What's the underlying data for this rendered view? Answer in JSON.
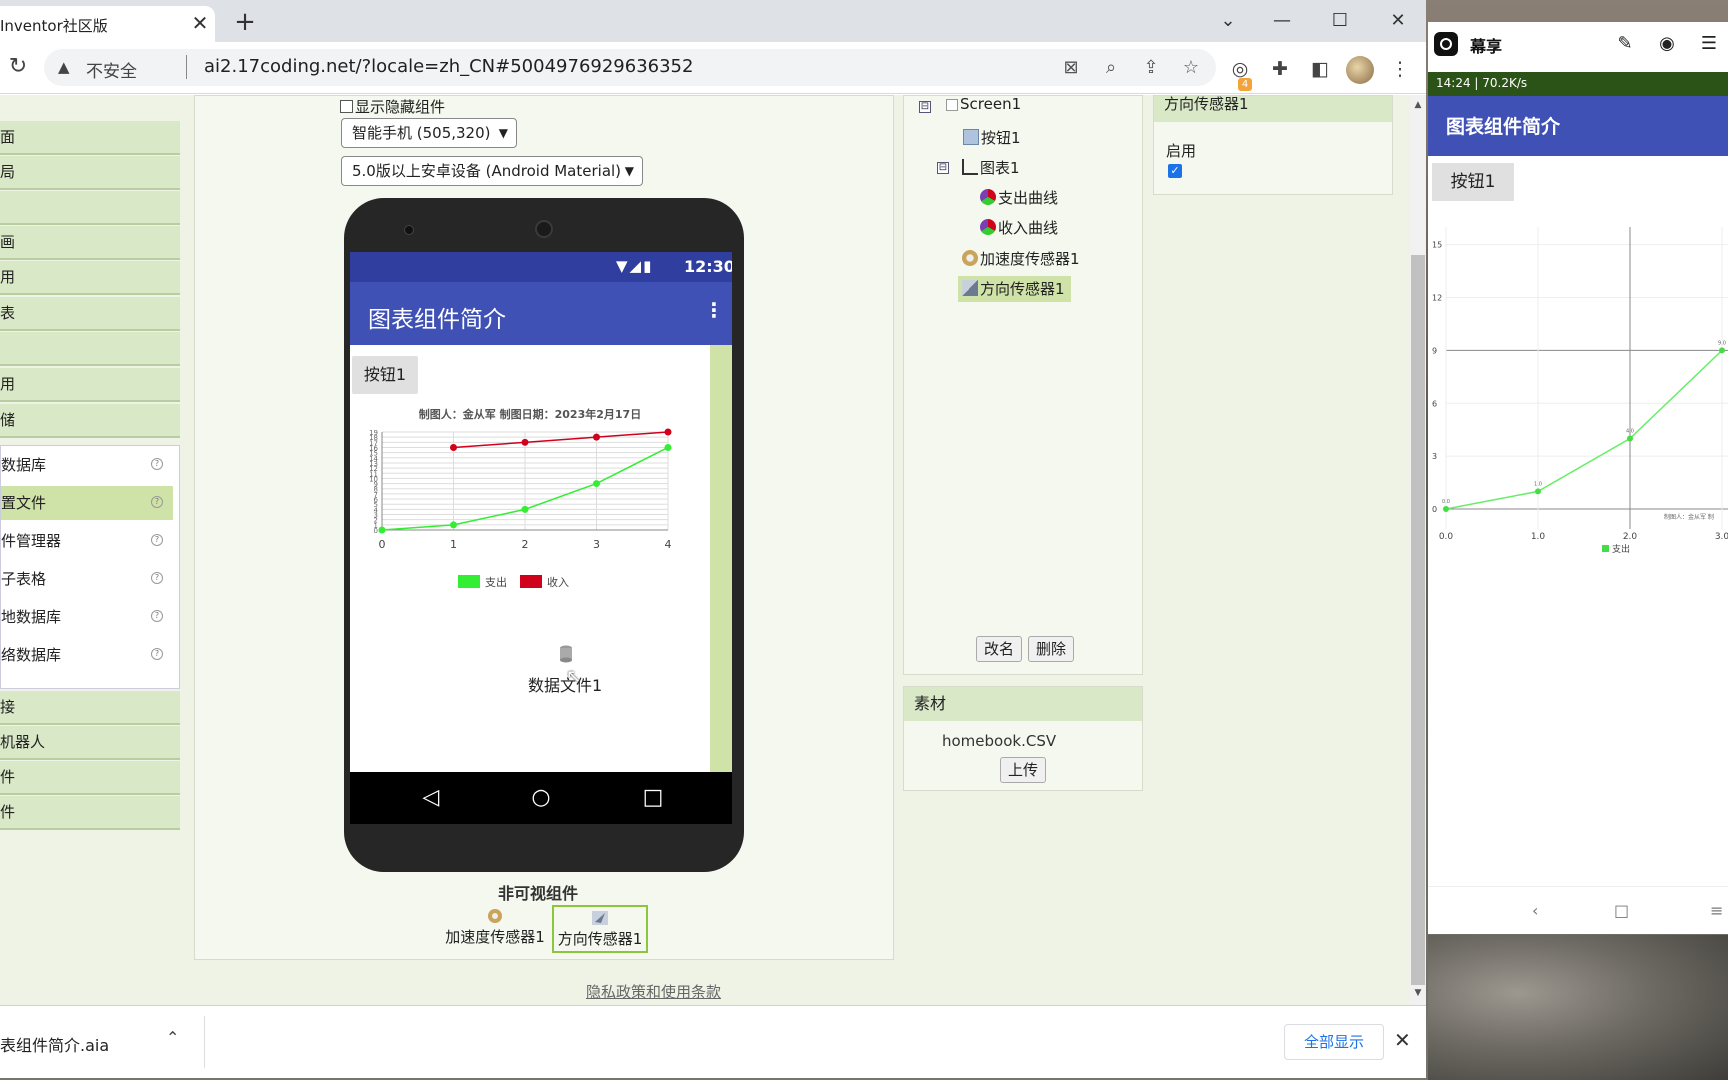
{
  "browser": {
    "tab_title": "Inventor社区版",
    "new_tab": "+",
    "insecure_label": "不安全",
    "url": "ai2.17coding.net/?locale=zh_CN#5004976929636352",
    "extension_badge": "4"
  },
  "palette": {
    "categories": [
      "面",
      "局",
      "",
      "画",
      "用",
      "表",
      "",
      "用",
      "储"
    ],
    "storage_items": [
      "数据库",
      "置文件",
      "件管理器",
      "子表格",
      "地数据库",
      "络数据库"
    ],
    "more_categories": [
      "接",
      "机器人",
      "件",
      "件"
    ],
    "help": "?"
  },
  "viewer": {
    "show_hidden_label": "显示隐藏组件",
    "device_select": "智能手机 (505,320)",
    "theme_select": "5.0版以上安卓设备 (Android Material)",
    "nonvisible_title": "非可视组件",
    "nonvisible_items": [
      "加速度传感器1",
      "方向传感器1"
    ]
  },
  "phone": {
    "time": "12:30",
    "app_title": "图表组件简介",
    "menu": "⋮",
    "button_label": "按钮1",
    "datafile_label": "数据文件1"
  },
  "chart_data": {
    "type": "line",
    "title": "制图人：金从军 制图日期：2023年2月17日",
    "x": [
      0,
      1,
      2,
      3,
      4
    ],
    "series": [
      {
        "name": "支出",
        "color": "#33ee33",
        "values": [
          0,
          1,
          4,
          9,
          16
        ]
      },
      {
        "name": "收入",
        "color": "#d0021b",
        "values": [
          null,
          16,
          17,
          18,
          19
        ]
      }
    ],
    "xlim": [
      0,
      4
    ],
    "ylim": [
      0,
      19
    ],
    "grid": true,
    "legend": "bottom"
  },
  "components": {
    "tree": [
      {
        "label": "Screen1"
      },
      {
        "label": "按钮1"
      },
      {
        "label": "图表1"
      },
      {
        "label": "支出曲线"
      },
      {
        "label": "收入曲线"
      },
      {
        "label": "加速度传感器1"
      },
      {
        "label": "方向传感器1"
      }
    ],
    "rename": "改名",
    "delete": "删除",
    "toggle_minus": "⊟"
  },
  "media": {
    "title": "素材",
    "file": "homebook.CSV",
    "upload": "上传"
  },
  "properties": {
    "component": "方向传感器1",
    "enabled_label": "启用",
    "enabled": true
  },
  "footer": {
    "privacy": "隐私政策和使用条款"
  },
  "download": {
    "file": "表组件简介.aia",
    "show_all": "全部显示"
  },
  "share": {
    "app_name": "幕享",
    "status": "14:24 | 70.2K/s",
    "app_title": "图表组件简介",
    "button_label": "按钮1",
    "chart": {
      "type": "line",
      "series_name": "支出",
      "x": [
        0,
        1,
        2,
        3
      ],
      "values": [
        0,
        1,
        4,
        9
      ],
      "point_labels": [
        "0.0",
        "1.0",
        "4.0",
        "9.0"
      ],
      "y_ticks": [
        "0",
        "3",
        "6",
        "9",
        "12",
        "15"
      ],
      "x_ticks": [
        "0.0",
        "1.0",
        "2.0",
        "3.0"
      ],
      "footer_text": "制图人：金从军 制"
    }
  }
}
